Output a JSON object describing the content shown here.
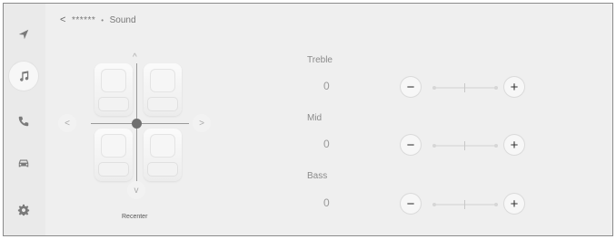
{
  "breadcrumb": {
    "back": "<",
    "path": "******",
    "separator": "•",
    "title": "Sound"
  },
  "sidebar": {
    "items": [
      {
        "icon": "navigation-arrow-icon",
        "active": false
      },
      {
        "icon": "music-note-icon",
        "active": true
      },
      {
        "icon": "phone-icon",
        "active": false
      },
      {
        "icon": "car-icon",
        "active": false
      },
      {
        "icon": "gear-icon",
        "active": false
      }
    ]
  },
  "balance": {
    "up": "^",
    "down": "v",
    "left": "<",
    "right": ">",
    "recenter_label": "Recenter"
  },
  "equalizer": [
    {
      "label": "Treble",
      "value": "0",
      "minus": "−",
      "plus": "+"
    },
    {
      "label": "Mid",
      "value": "0",
      "minus": "−",
      "plus": "+"
    },
    {
      "label": "Bass",
      "value": "0",
      "minus": "−",
      "plus": "+"
    }
  ]
}
